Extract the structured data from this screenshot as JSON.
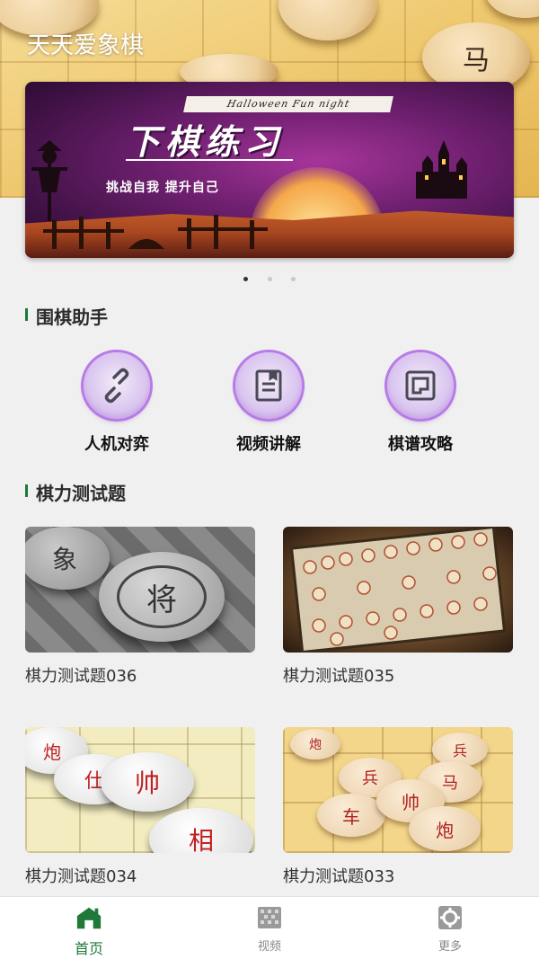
{
  "app": {
    "title": "天天爱象棋"
  },
  "banner": {
    "tag": "Halloween Fun night",
    "title": "下棋练习",
    "subtitle": "挑战自我  提升自己",
    "page_count": 3,
    "active_page": 1
  },
  "assistant": {
    "title": "围棋助手",
    "tools": [
      {
        "label": "人机对弈",
        "icon": "link-icon"
      },
      {
        "label": "视频讲解",
        "icon": "book-icon"
      },
      {
        "label": "棋谱攻略",
        "icon": "board-icon"
      }
    ]
  },
  "tests": {
    "title": "棋力测试题",
    "items": [
      {
        "label": "棋力测试题036"
      },
      {
        "label": "棋力测试题035"
      },
      {
        "label": "棋力测试题034"
      },
      {
        "label": "棋力测试题033"
      }
    ]
  },
  "nav": {
    "items": [
      {
        "label": "首页",
        "icon": "home-icon",
        "active": true
      },
      {
        "label": "视频",
        "icon": "video-icon",
        "active": false
      },
      {
        "label": "更多",
        "icon": "gear-icon",
        "active": false
      }
    ]
  },
  "colors": {
    "accent": "#1f7a3a",
    "icon_ring": "#b77be6"
  }
}
